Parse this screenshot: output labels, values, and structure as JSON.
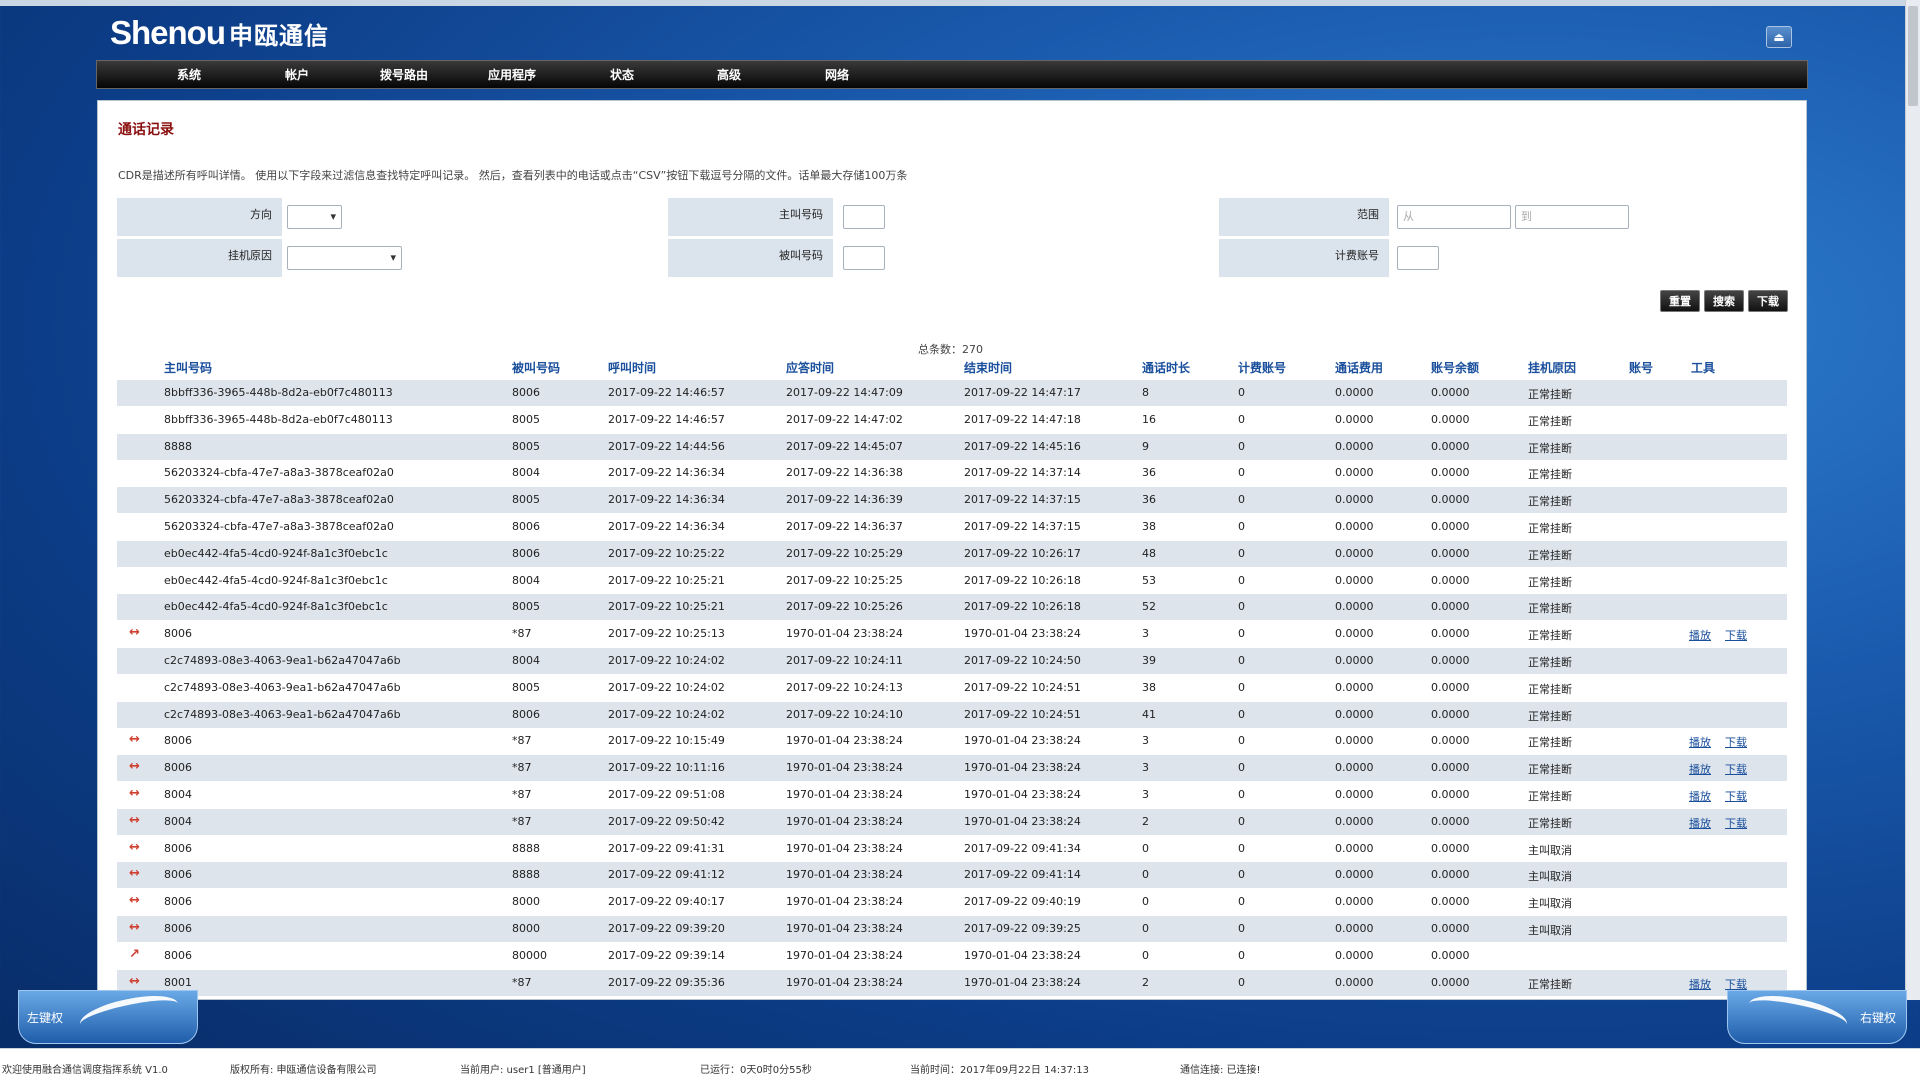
{
  "app": {
    "logo_en": "Shenou",
    "logo_cn": "申瓯通信",
    "window_button": "⏏"
  },
  "nav": [
    "系统",
    "帐户",
    "拨号路由",
    "应用程序",
    "状态",
    "高级",
    "网络"
  ],
  "page": {
    "title": "通话记录",
    "description": "CDR是描述所有呼叫详情。 使用以下字段来过滤信息查找特定呼叫记录。 然后，查看列表中的电话或点击“CSV”按钮下载逗号分隔的文件。话单最大存储100万条"
  },
  "filters": {
    "direction_label": "方向",
    "hangup_label": "挂机原因",
    "caller_label": "主叫号码",
    "callee_label": "被叫号码",
    "range_label": "范围",
    "billing_label": "计费账号",
    "range_from_placeholder": "从",
    "range_to_placeholder": "到"
  },
  "buttons": {
    "reset": "重置",
    "search": "搜索",
    "download": "下载"
  },
  "total": "总条数：270",
  "columns": [
    "主叫号码",
    "被叫号码",
    "呼叫时间",
    "应答时间",
    "结束时间",
    "通话时长",
    "计费账号",
    "通话费用",
    "账号余额",
    "挂机原因",
    "账号",
    "工具"
  ],
  "rows": [
    {
      "dir": "",
      "caller": "8bbff336-3965-448b-8d2a-eb0f7c480113",
      "callee": "8006",
      "call": "2017-09-22 14:46:57",
      "answer": "2017-09-22 14:47:09",
      "end": "2017-09-22 14:47:17",
      "dur": "8",
      "acct": "0",
      "fee": "0.0000",
      "bal": "0.0000",
      "reason": "正常挂断",
      "play": "",
      "dl": ""
    },
    {
      "dir": "",
      "caller": "8bbff336-3965-448b-8d2a-eb0f7c480113",
      "callee": "8005",
      "call": "2017-09-22 14:46:57",
      "answer": "2017-09-22 14:47:02",
      "end": "2017-09-22 14:47:18",
      "dur": "16",
      "acct": "0",
      "fee": "0.0000",
      "bal": "0.0000",
      "reason": "正常挂断",
      "play": "",
      "dl": ""
    },
    {
      "dir": "",
      "caller": "8888",
      "callee": "8005",
      "call": "2017-09-22 14:44:56",
      "answer": "2017-09-22 14:45:07",
      "end": "2017-09-22 14:45:16",
      "dur": "9",
      "acct": "0",
      "fee": "0.0000",
      "bal": "0.0000",
      "reason": "正常挂断",
      "play": "",
      "dl": ""
    },
    {
      "dir": "",
      "caller": "56203324-cbfa-47e7-a8a3-3878ceaf02a0",
      "callee": "8004",
      "call": "2017-09-22 14:36:34",
      "answer": "2017-09-22 14:36:38",
      "end": "2017-09-22 14:37:14",
      "dur": "36",
      "acct": "0",
      "fee": "0.0000",
      "bal": "0.0000",
      "reason": "正常挂断",
      "play": "",
      "dl": ""
    },
    {
      "dir": "",
      "caller": "56203324-cbfa-47e7-a8a3-3878ceaf02a0",
      "callee": "8005",
      "call": "2017-09-22 14:36:34",
      "answer": "2017-09-22 14:36:39",
      "end": "2017-09-22 14:37:15",
      "dur": "36",
      "acct": "0",
      "fee": "0.0000",
      "bal": "0.0000",
      "reason": "正常挂断",
      "play": "",
      "dl": ""
    },
    {
      "dir": "",
      "caller": "56203324-cbfa-47e7-a8a3-3878ceaf02a0",
      "callee": "8006",
      "call": "2017-09-22 14:36:34",
      "answer": "2017-09-22 14:36:37",
      "end": "2017-09-22 14:37:15",
      "dur": "38",
      "acct": "0",
      "fee": "0.0000",
      "bal": "0.0000",
      "reason": "正常挂断",
      "play": "",
      "dl": ""
    },
    {
      "dir": "",
      "caller": "eb0ec442-4fa5-4cd0-924f-8a1c3f0ebc1c",
      "callee": "8006",
      "call": "2017-09-22 10:25:22",
      "answer": "2017-09-22 10:25:29",
      "end": "2017-09-22 10:26:17",
      "dur": "48",
      "acct": "0",
      "fee": "0.0000",
      "bal": "0.0000",
      "reason": "正常挂断",
      "play": "",
      "dl": ""
    },
    {
      "dir": "",
      "caller": "eb0ec442-4fa5-4cd0-924f-8a1c3f0ebc1c",
      "callee": "8004",
      "call": "2017-09-22 10:25:21",
      "answer": "2017-09-22 10:25:25",
      "end": "2017-09-22 10:26:18",
      "dur": "53",
      "acct": "0",
      "fee": "0.0000",
      "bal": "0.0000",
      "reason": "正常挂断",
      "play": "",
      "dl": ""
    },
    {
      "dir": "",
      "caller": "eb0ec442-4fa5-4cd0-924f-8a1c3f0ebc1c",
      "callee": "8005",
      "call": "2017-09-22 10:25:21",
      "answer": "2017-09-22 10:25:26",
      "end": "2017-09-22 10:26:18",
      "dur": "52",
      "acct": "0",
      "fee": "0.0000",
      "bal": "0.0000",
      "reason": "正常挂断",
      "play": "",
      "dl": ""
    },
    {
      "dir": "↔",
      "caller": "8006",
      "callee": "*87",
      "call": "2017-09-22 10:25:13",
      "answer": "1970-01-04 23:38:24",
      "end": "1970-01-04 23:38:24",
      "dur": "3",
      "acct": "0",
      "fee": "0.0000",
      "bal": "0.0000",
      "reason": "正常挂断",
      "play": "播放",
      "dl": "下载"
    },
    {
      "dir": "",
      "caller": "c2c74893-08e3-4063-9ea1-b62a47047a6b",
      "callee": "8004",
      "call": "2017-09-22 10:24:02",
      "answer": "2017-09-22 10:24:11",
      "end": "2017-09-22 10:24:50",
      "dur": "39",
      "acct": "0",
      "fee": "0.0000",
      "bal": "0.0000",
      "reason": "正常挂断",
      "play": "",
      "dl": ""
    },
    {
      "dir": "",
      "caller": "c2c74893-08e3-4063-9ea1-b62a47047a6b",
      "callee": "8005",
      "call": "2017-09-22 10:24:02",
      "answer": "2017-09-22 10:24:13",
      "end": "2017-09-22 10:24:51",
      "dur": "38",
      "acct": "0",
      "fee": "0.0000",
      "bal": "0.0000",
      "reason": "正常挂断",
      "play": "",
      "dl": ""
    },
    {
      "dir": "",
      "caller": "c2c74893-08e3-4063-9ea1-b62a47047a6b",
      "callee": "8006",
      "call": "2017-09-22 10:24:02",
      "answer": "2017-09-22 10:24:10",
      "end": "2017-09-22 10:24:51",
      "dur": "41",
      "acct": "0",
      "fee": "0.0000",
      "bal": "0.0000",
      "reason": "正常挂断",
      "play": "",
      "dl": ""
    },
    {
      "dir": "↔",
      "caller": "8006",
      "callee": "*87",
      "call": "2017-09-22 10:15:49",
      "answer": "1970-01-04 23:38:24",
      "end": "1970-01-04 23:38:24",
      "dur": "3",
      "acct": "0",
      "fee": "0.0000",
      "bal": "0.0000",
      "reason": "正常挂断",
      "play": "播放",
      "dl": "下载"
    },
    {
      "dir": "↔",
      "caller": "8006",
      "callee": "*87",
      "call": "2017-09-22 10:11:16",
      "answer": "1970-01-04 23:38:24",
      "end": "1970-01-04 23:38:24",
      "dur": "3",
      "acct": "0",
      "fee": "0.0000",
      "bal": "0.0000",
      "reason": "正常挂断",
      "play": "播放",
      "dl": "下载"
    },
    {
      "dir": "↔",
      "caller": "8004",
      "callee": "*87",
      "call": "2017-09-22 09:51:08",
      "answer": "1970-01-04 23:38:24",
      "end": "1970-01-04 23:38:24",
      "dur": "3",
      "acct": "0",
      "fee": "0.0000",
      "bal": "0.0000",
      "reason": "正常挂断",
      "play": "播放",
      "dl": "下载"
    },
    {
      "dir": "↔",
      "caller": "8004",
      "callee": "*87",
      "call": "2017-09-22 09:50:42",
      "answer": "1970-01-04 23:38:24",
      "end": "1970-01-04 23:38:24",
      "dur": "2",
      "acct": "0",
      "fee": "0.0000",
      "bal": "0.0000",
      "reason": "正常挂断",
      "play": "播放",
      "dl": "下载"
    },
    {
      "dir": "↔",
      "caller": "8006",
      "callee": "8888",
      "call": "2017-09-22 09:41:31",
      "answer": "1970-01-04 23:38:24",
      "end": "2017-09-22 09:41:34",
      "dur": "0",
      "acct": "0",
      "fee": "0.0000",
      "bal": "0.0000",
      "reason": "主叫取消",
      "play": "",
      "dl": ""
    },
    {
      "dir": "↔",
      "caller": "8006",
      "callee": "8888",
      "call": "2017-09-22 09:41:12",
      "answer": "1970-01-04 23:38:24",
      "end": "2017-09-22 09:41:14",
      "dur": "0",
      "acct": "0",
      "fee": "0.0000",
      "bal": "0.0000",
      "reason": "主叫取消",
      "play": "",
      "dl": ""
    },
    {
      "dir": "↔",
      "caller": "8006",
      "callee": "8000",
      "call": "2017-09-22 09:40:17",
      "answer": "1970-01-04 23:38:24",
      "end": "2017-09-22 09:40:19",
      "dur": "0",
      "acct": "0",
      "fee": "0.0000",
      "bal": "0.0000",
      "reason": "主叫取消",
      "play": "",
      "dl": ""
    },
    {
      "dir": "↔",
      "caller": "8006",
      "callee": "8000",
      "call": "2017-09-22 09:39:20",
      "answer": "1970-01-04 23:38:24",
      "end": "2017-09-22 09:39:25",
      "dur": "0",
      "acct": "0",
      "fee": "0.0000",
      "bal": "0.0000",
      "reason": "主叫取消",
      "play": "",
      "dl": ""
    },
    {
      "dir": "↗",
      "caller": "8006",
      "callee": "80000",
      "call": "2017-09-22 09:39:14",
      "answer": "1970-01-04 23:38:24",
      "end": "1970-01-04 23:38:24",
      "dur": "0",
      "acct": "0",
      "fee": "0.0000",
      "bal": "0.0000",
      "reason": "",
      "play": "",
      "dl": ""
    },
    {
      "dir": "↔",
      "caller": "8001",
      "callee": "*87",
      "call": "2017-09-22 09:35:36",
      "answer": "1970-01-04 23:38:24",
      "end": "1970-01-04 23:38:24",
      "dur": "2",
      "acct": "0",
      "fee": "0.0000",
      "bal": "0.0000",
      "reason": "正常挂断",
      "play": "播放",
      "dl": "下载"
    }
  ],
  "corners": {
    "left": "左键权",
    "right": "右键权"
  },
  "footer": {
    "welcome": "欢迎使用融合通信调度指挥系统 V1.0",
    "copyright": "版权所有: 申瓯通信设备有限公司",
    "user": "当前用户: user1 [普通用户]",
    "uptime": "已运行：0天0时0分55秒",
    "time": "当前时间：2017年09月22日 14:37:13",
    "conn": "通信连接: 已连接!"
  }
}
